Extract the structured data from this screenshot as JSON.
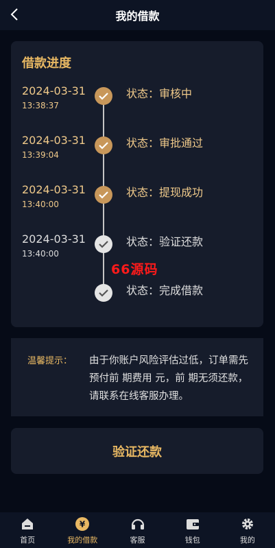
{
  "header": {
    "title": "我的借款"
  },
  "progress": {
    "title": "借款进度",
    "steps": [
      {
        "date": "2024-03-31",
        "time": "13:38:37",
        "status": "状态：审核中",
        "state": "done"
      },
      {
        "date": "2024-03-31",
        "time": "13:39:04",
        "status": "状态：审批通过",
        "state": "done"
      },
      {
        "date": "2024-03-31",
        "time": "13:40:00",
        "status": "状态：提现成功",
        "state": "done"
      },
      {
        "date": "2024-03-31",
        "time": "13:40:00",
        "status": "状态：验证还款",
        "state": "pending"
      },
      {
        "date": "",
        "time": "",
        "status": "状态：完成借款",
        "state": "pending"
      }
    ],
    "watermark": "66源码"
  },
  "notice": {
    "label": "温馨提示：",
    "text": "由于你账户风险评估过低，订单需先预付前 期费用 元，前 期无须还款，请联系在线客服办理。"
  },
  "verify_button": "验证还款",
  "tabbar": [
    {
      "label": "首页",
      "icon": "home-icon",
      "active": false
    },
    {
      "label": "我的借款",
      "icon": "yuan-coin-icon",
      "active": true
    },
    {
      "label": "客服",
      "icon": "headset-icon",
      "active": false
    },
    {
      "label": "钱包",
      "icon": "wallet-icon",
      "active": false
    },
    {
      "label": "我的",
      "icon": "gear-icon",
      "active": false
    }
  ],
  "colors": {
    "accent": "#e8b863",
    "done_dot": "#c8975a",
    "pending_dot": "#e5e5e5",
    "background": "#060b17",
    "card": "#161c2b"
  }
}
